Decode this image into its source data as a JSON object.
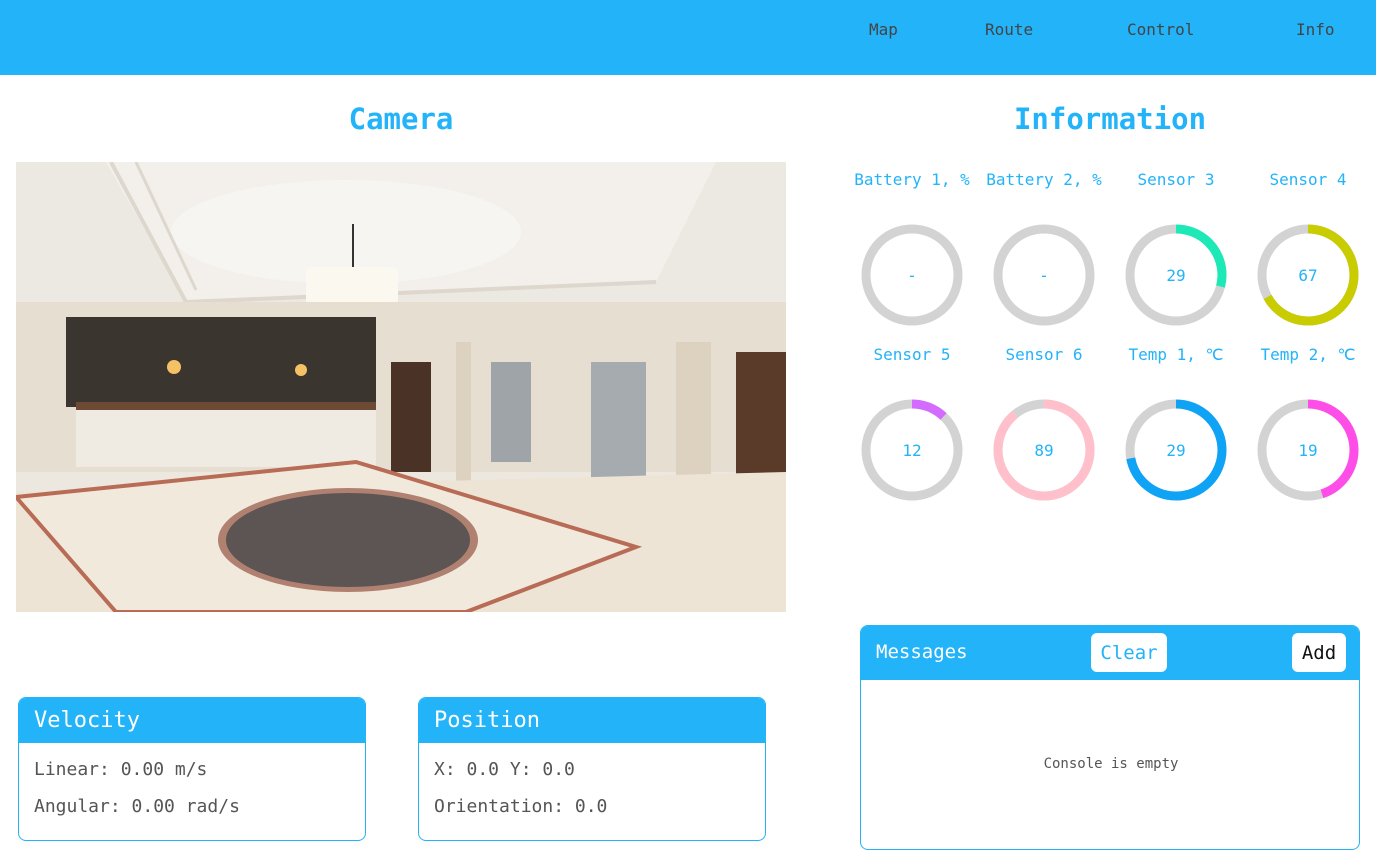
{
  "nav": {
    "items": [
      "Map",
      "Route",
      "Control",
      "Info"
    ]
  },
  "camera": {
    "title": "Camera"
  },
  "info": {
    "title": "Information",
    "gauges": [
      {
        "label": "Battery 1, %",
        "value": "-",
        "fraction": 0,
        "color": "#d3d3d3"
      },
      {
        "label": "Battery 2, %",
        "value": "-",
        "fraction": 0,
        "color": "#d3d3d3"
      },
      {
        "label": "Sensor 3",
        "value": "29",
        "fraction": 0.29,
        "color": "#1de9b6"
      },
      {
        "label": "Sensor 4",
        "value": "67",
        "fraction": 0.67,
        "color": "#c8cc00"
      },
      {
        "label": "Sensor 5",
        "value": "12",
        "fraction": 0.12,
        "color": "#d36bff"
      },
      {
        "label": "Sensor 6",
        "value": "89",
        "fraction": 0.89,
        "color": "#ffc0cb"
      },
      {
        "label": "Temp 1, ℃",
        "value": "29",
        "fraction": 0.72,
        "color": "#0fa3f5"
      },
      {
        "label": "Temp 2, ℃",
        "value": "19",
        "fraction": 0.45,
        "color": "#ff4ee8"
      }
    ]
  },
  "velocity": {
    "title": "Velocity",
    "linear": "Linear: 0.00 m/s",
    "angular": "Angular: 0.00 rad/s"
  },
  "position": {
    "title": "Position",
    "xy": "X: 0.0 Y: 0.0",
    "orientation": "Orientation: 0.0"
  },
  "messages": {
    "title": "Messages",
    "clear_label": "Clear",
    "add_label": "Add",
    "empty_text": "Console is empty"
  },
  "colors": {
    "accent": "#22b3f9",
    "track": "#d3d3d3"
  }
}
